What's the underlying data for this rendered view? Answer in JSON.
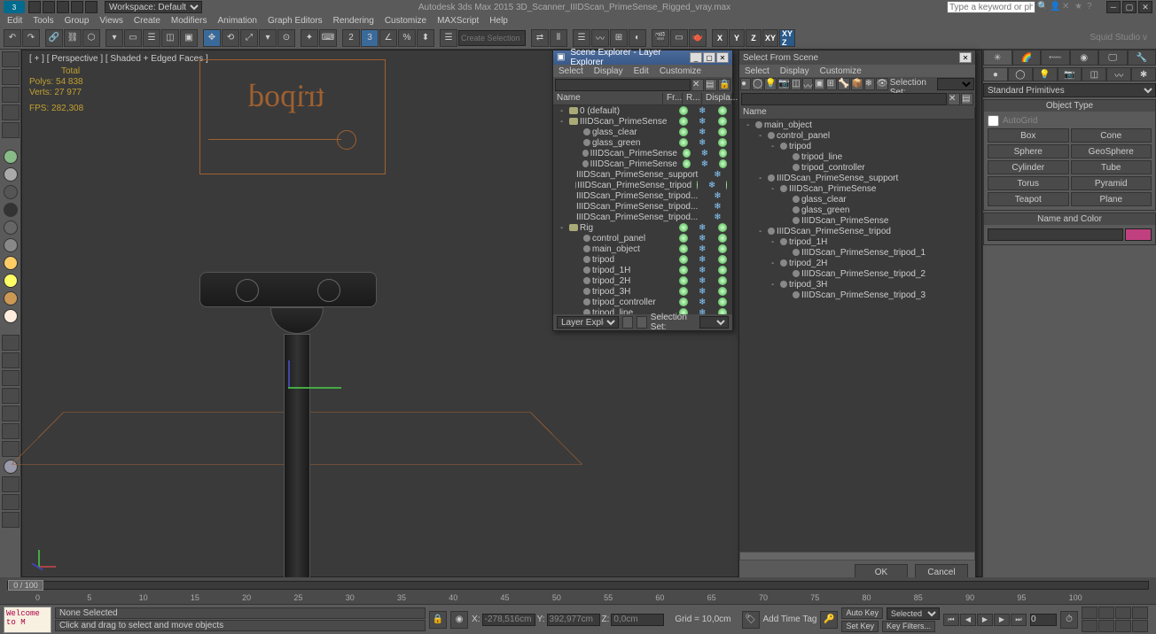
{
  "app": {
    "title": "Autodesk 3ds Max 2015   3D_Scanner_IIIDScan_PrimeSense_Rigged_vray.max",
    "workspace_label": "Workspace: Default",
    "search_placeholder": "Type a keyword or phrase",
    "workspace_name": "Squid Studio v"
  },
  "menus": [
    "Edit",
    "Tools",
    "Group",
    "Views",
    "Create",
    "Modifiers",
    "Animation",
    "Graph Editors",
    "Rendering",
    "Customize",
    "MAXScript",
    "Help"
  ],
  "toolbar": {
    "named_selection_placeholder": "Create Selection Se"
  },
  "viewport": {
    "label": "[ + ] [ Perspective ] [ Shaded + Edged Faces ]",
    "stats": {
      "header": "Total",
      "polys_label": "Polys:",
      "polys": "54 838",
      "verts_label": "Verts:",
      "verts": "27 977",
      "fps_label": "FPS:",
      "fps": "282,308"
    },
    "ref_text": "tripod"
  },
  "command_panel": {
    "dropdown": "Standard Primitives",
    "rollout_objtype": "Object Type",
    "autogrid": "AutoGrid",
    "buttons": [
      [
        "Box",
        "Cone"
      ],
      [
        "Sphere",
        "GeoSphere"
      ],
      [
        "Cylinder",
        "Tube"
      ],
      [
        "Torus",
        "Pyramid"
      ],
      [
        "Teapot",
        "Plane"
      ]
    ],
    "rollout_namecolor": "Name and Color"
  },
  "scene_explorer": {
    "title": "Scene Explorer - Layer Explorer",
    "menus": [
      "Select",
      "Display",
      "Edit",
      "Customize"
    ],
    "cols": [
      "Name",
      "Fr...",
      "R...",
      "Displa..."
    ],
    "tree": [
      {
        "d": 0,
        "t": "layer",
        "exp": "-",
        "label": "0 (default)"
      },
      {
        "d": 0,
        "t": "layer",
        "exp": "-",
        "label": "IIIDScan_PrimeSense"
      },
      {
        "d": 1,
        "t": "obj",
        "label": "glass_clear"
      },
      {
        "d": 1,
        "t": "obj",
        "label": "glass_green"
      },
      {
        "d": 1,
        "t": "obj",
        "label": "IIIDScan_PrimeSense"
      },
      {
        "d": 1,
        "t": "obj",
        "label": "IIIDScan_PrimeSense"
      },
      {
        "d": 1,
        "t": "obj",
        "label": "IIIDScan_PrimeSense_support"
      },
      {
        "d": 1,
        "t": "obj",
        "label": "IIIDScan_PrimeSense_tripod"
      },
      {
        "d": 1,
        "t": "obj",
        "label": "IIIDScan_PrimeSense_tripod..."
      },
      {
        "d": 1,
        "t": "obj",
        "label": "IIIDScan_PrimeSense_tripod..."
      },
      {
        "d": 1,
        "t": "obj",
        "label": "IIIDScan_PrimeSense_tripod..."
      },
      {
        "d": 0,
        "t": "layer",
        "exp": "-",
        "label": "Rig"
      },
      {
        "d": 1,
        "t": "obj",
        "label": "control_panel"
      },
      {
        "d": 1,
        "t": "obj",
        "label": "main_object"
      },
      {
        "d": 1,
        "t": "obj",
        "label": "tripod"
      },
      {
        "d": 1,
        "t": "obj",
        "label": "tripod_1H"
      },
      {
        "d": 1,
        "t": "obj",
        "label": "tripod_2H"
      },
      {
        "d": 1,
        "t": "obj",
        "label": "tripod_3H"
      },
      {
        "d": 1,
        "t": "obj",
        "label": "tripod_controller"
      },
      {
        "d": 1,
        "t": "obj",
        "label": "tripod_line"
      }
    ],
    "status_label": "Layer Explorer",
    "selset_label": "Selection Set:"
  },
  "select_from_scene": {
    "title": "Select From Scene",
    "menus": [
      "Select",
      "Display",
      "Customize"
    ],
    "cols": [
      "Name"
    ],
    "selset_label": "Selection Set:",
    "tree": [
      {
        "d": 0,
        "exp": "-",
        "label": "main_object"
      },
      {
        "d": 1,
        "exp": "-",
        "label": "control_panel"
      },
      {
        "d": 2,
        "exp": "-",
        "label": "tripod"
      },
      {
        "d": 3,
        "exp": "",
        "label": "tripod_line"
      },
      {
        "d": 3,
        "exp": "",
        "label": "tripod_controller"
      },
      {
        "d": 1,
        "exp": "-",
        "label": "IIIDScan_PrimeSense_support"
      },
      {
        "d": 2,
        "exp": "-",
        "label": "IIIDScan_PrimeSense"
      },
      {
        "d": 3,
        "exp": "",
        "label": "glass_clear"
      },
      {
        "d": 3,
        "exp": "",
        "label": "glass_green"
      },
      {
        "d": 3,
        "exp": "",
        "label": "IIIDScan_PrimeSense"
      },
      {
        "d": 1,
        "exp": "-",
        "label": "IIIDScan_PrimeSense_tripod"
      },
      {
        "d": 2,
        "exp": "-",
        "label": "tripod_1H"
      },
      {
        "d": 3,
        "exp": "",
        "label": "IIIDScan_PrimeSense_tripod_1"
      },
      {
        "d": 2,
        "exp": "-",
        "label": "tripod_2H"
      },
      {
        "d": 3,
        "exp": "",
        "label": "IIIDScan_PrimeSense_tripod_2"
      },
      {
        "d": 2,
        "exp": "-",
        "label": "tripod_3H"
      },
      {
        "d": 3,
        "exp": "",
        "label": "IIIDScan_PrimeSense_tripod_3"
      }
    ],
    "ok": "OK",
    "cancel": "Cancel"
  },
  "timeline": {
    "thumb": "0 / 100",
    "ticks": [
      "0",
      "5",
      "10",
      "15",
      "20",
      "25",
      "30",
      "35",
      "40",
      "45",
      "50",
      "55",
      "60",
      "65",
      "70",
      "75",
      "80",
      "85",
      "90",
      "95",
      "100"
    ]
  },
  "status": {
    "script": "Welcome to M",
    "msg1": "None Selected",
    "msg2": "Click and drag to select and move objects",
    "x": "-278,516cm",
    "y": "392,977cm",
    "z": "0,0cm",
    "grid": "Grid = 10,0cm",
    "autokey": "Auto Key",
    "setkey": "Set Key",
    "selected": "Selected",
    "keyfilters": "Key Filters...",
    "addtag": "Add Time Tag"
  }
}
